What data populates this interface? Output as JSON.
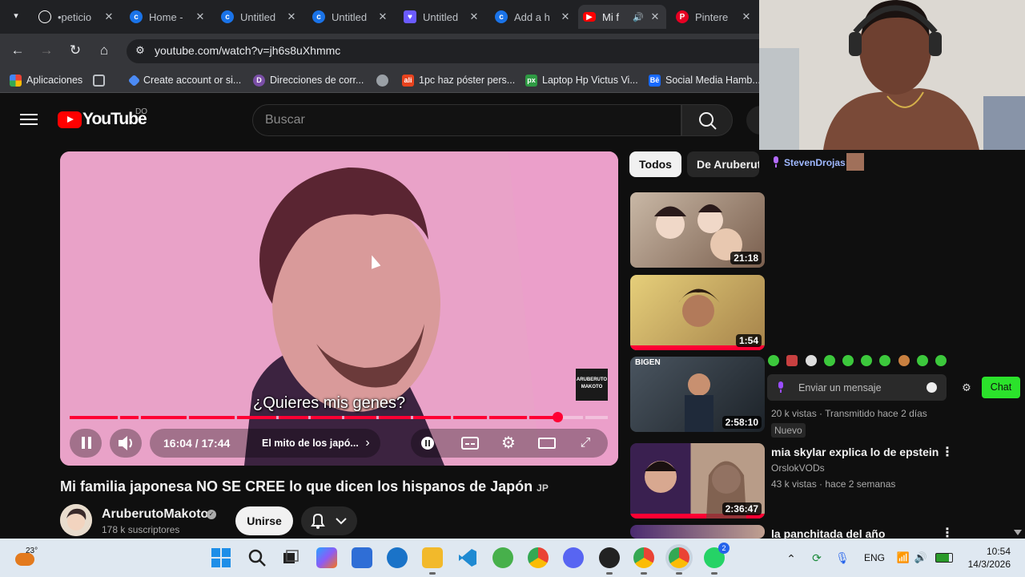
{
  "tabs": [
    {
      "title": "•peticio",
      "favicon": "openai-icon",
      "color": "#ffffff",
      "active": false
    },
    {
      "title": "Home -",
      "favicon": "c-circle-icon",
      "color": "#1a73e8",
      "active": false
    },
    {
      "title": "Untitled",
      "favicon": "c-circle-icon",
      "color": "#1a73e8",
      "active": false
    },
    {
      "title": "Untitled",
      "favicon": "c-circle-icon",
      "color": "#1a73e8",
      "active": false
    },
    {
      "title": "Untitled",
      "favicon": "heart-shield-icon",
      "color": "#6b5bff",
      "active": false
    },
    {
      "title": "Add a h",
      "favicon": "c-circle-icon",
      "color": "#1a73e8",
      "active": false
    },
    {
      "title": "Mi f",
      "favicon": "youtube-icon",
      "color": "#ff0000",
      "active": true
    },
    {
      "title": "Pintere",
      "favicon": "pinterest-icon",
      "color": "#e60023",
      "active": false
    }
  ],
  "toolbar": {
    "url": "youtube.com/watch?v=jh6s8uXhmmc"
  },
  "bookmarks": [
    {
      "label": "Aplicaciones",
      "icon": "apps-grid-icon",
      "color": "#ea4335"
    },
    {
      "label": "",
      "icon": "grid-icon",
      "color": "#5f6368"
    },
    {
      "label": "Create account or si...",
      "icon": "star-icon",
      "color": "#4c8bf5"
    },
    {
      "label": "Direcciones de corr...",
      "icon": "address-icon",
      "color": "#7a4ea6"
    },
    {
      "label": "",
      "icon": "globe-icon",
      "color": "#5f6368"
    },
    {
      "label": "1pc haz póster pers...",
      "icon": "aliexpress-icon",
      "color": "#e8431e"
    },
    {
      "label": "Laptop Hp Victus Vi...",
      "icon": "px-icon",
      "color": "#2e9a43"
    },
    {
      "label": "Social Media Hamb...",
      "icon": "behance-icon",
      "color": "#1769ff"
    }
  ],
  "youtube": {
    "logo_text": "YouTube",
    "country": "DO",
    "search_placeholder": "Buscar"
  },
  "player": {
    "subtitle": "¿Quieres mis genes?",
    "watermark": "ARUBERUTO MAKOTO",
    "current_time": "16:04",
    "duration": "17:44",
    "time_display": "16:04 / 17:44",
    "chapter": "El mito de los japó...",
    "progress": 0.906
  },
  "video": {
    "title": "Mi familia japonesa NO SE CREE lo que dicen los hispanos de Japón",
    "title_flag": "JP",
    "channel": "AruberutoMakoto",
    "subscribers": "178 k suscriptores",
    "join_label": "Unirse"
  },
  "sidebar": {
    "chips": [
      "Todos",
      "De Aruberuto"
    ],
    "items": [
      {
        "duration": "21:18",
        "title": "",
        "channel": "",
        "meta": ""
      },
      {
        "duration": "1:54",
        "title": "",
        "channel": "",
        "meta": ""
      },
      {
        "duration": "2:58:10",
        "title": "",
        "channel": "",
        "meta": "20 k vistas · Transmitido hace 2 días",
        "badge": "Nuevo",
        "thumb_label": "BIGEN"
      },
      {
        "duration": "2:36:47",
        "title": "mia skylar explica lo de epstein",
        "channel": "OrslokVODs",
        "meta": "43 k vistas · hace 2 semanas"
      },
      {
        "duration": "",
        "title": "la panchitada del año",
        "channel": "",
        "meta": ""
      }
    ]
  },
  "stream_overlay": {
    "chat_user": "StevenDrojas:",
    "chat_placeholder": "Enviar un mensaje",
    "chat_button": "Chat",
    "accent": "#2be22b"
  },
  "taskbar": {
    "weather_temp": "23°",
    "language": "ENG",
    "time": "10:54",
    "date": "14/3/2026",
    "whatsapp_badge": "2"
  }
}
